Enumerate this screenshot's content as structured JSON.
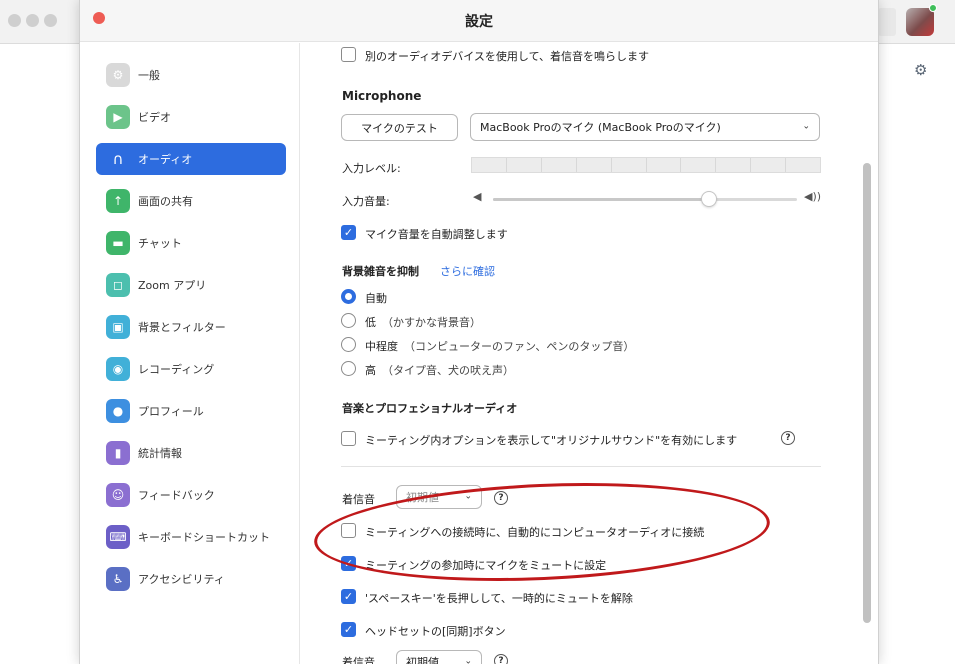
{
  "window": {
    "title": "設定"
  },
  "sidebar": {
    "items": [
      {
        "label": "一般",
        "icon": "gear-icon",
        "color": "#d9d9d9",
        "glyph": "⚙",
        "active": false
      },
      {
        "label": "ビデオ",
        "icon": "video-camera-icon",
        "color": "#6cc48a",
        "glyph": "▶",
        "active": false
      },
      {
        "label": "オーディオ",
        "icon": "headphones-icon",
        "color": "#2d6cdf",
        "glyph": "∩",
        "active": true
      },
      {
        "label": "画面の共有",
        "icon": "share-screen-icon",
        "color": "#3fb56a",
        "glyph": "↑",
        "active": false
      },
      {
        "label": "チャット",
        "icon": "chat-bubble-icon",
        "color": "#3fb56a",
        "glyph": "▬",
        "active": false
      },
      {
        "label": "Zoom アプリ",
        "icon": "apps-icon",
        "color": "#4cbfae",
        "glyph": "◻",
        "active": false
      },
      {
        "label": "背景とフィルター",
        "icon": "background-icon",
        "color": "#41b0d8",
        "glyph": "▣",
        "active": false
      },
      {
        "label": "レコーディング",
        "icon": "record-icon",
        "color": "#41b0d8",
        "glyph": "◉",
        "active": false
      },
      {
        "label": "プロフィール",
        "icon": "profile-icon",
        "color": "#3d8fe0",
        "glyph": "●",
        "active": false
      },
      {
        "label": "統計情報",
        "icon": "statistics-icon",
        "color": "#8b6fd1",
        "glyph": "▮",
        "active": false
      },
      {
        "label": "フィードバック",
        "icon": "feedback-smile-icon",
        "color": "#8b6fd1",
        "glyph": "☺",
        "active": false
      },
      {
        "label": "キーボードショートカット",
        "icon": "keyboard-icon",
        "color": "#6c5fc7",
        "glyph": "⌨",
        "active": false
      },
      {
        "label": "アクセシビリティ",
        "icon": "accessibility-icon",
        "color": "#5a6fc4",
        "glyph": "♿",
        "active": false
      }
    ]
  },
  "audio": {
    "separate_device_label": "別のオーディオデバイスを使用して、着信音を鳴らします",
    "separate_device_checked": false,
    "microphone_heading": "Microphone",
    "test_mic_button": "マイクのテスト",
    "mic_select_value": "MacBook Proのマイク (MacBook Proのマイク)",
    "input_level_label": "入力レベル:",
    "input_level_segments": 10,
    "input_volume_label": "入力音量:",
    "input_volume_value": 0.71,
    "auto_adjust_label": "マイク音量を自動調整します",
    "auto_adjust_checked": true,
    "noise_heading": "背景雑音を抑制",
    "noise_more_link": "さらに確認",
    "noise_options": [
      {
        "label": "自動",
        "hint": "",
        "checked": true
      },
      {
        "label": "低",
        "hint": "（かすかな背景音）",
        "checked": false
      },
      {
        "label": "中程度",
        "hint": "（コンピューターのファン、ペンのタップ音）",
        "checked": false
      },
      {
        "label": "高",
        "hint": "（タイプ音、犬の吠え声）",
        "checked": false
      }
    ],
    "music_heading": "音楽とプロフェショナルオーディオ",
    "original_sound_label": "ミーティング内オプションを表示して\"オリジナルサウンド\"を有効にします",
    "original_sound_checked": false,
    "ringtone_label": "着信音",
    "ringtone_value": "初期値",
    "auto_join_label": "ミーティングへの接続時に、自動的にコンピュータオーディオに接続",
    "auto_join_checked": false,
    "mute_on_join_label": "ミーティングの参加時にマイクをミュートに設定",
    "mute_on_join_checked": true,
    "space_unmute_label": "'スペースキー'を長押しして、一時的にミュートを解除",
    "space_unmute_checked": true,
    "headset_sync_label": "ヘッドセットの[同期]ボタン",
    "headset_sync_checked": true,
    "ringtone2_label": "着信音",
    "ringtone2_value": "初期値"
  },
  "colors": {
    "accent": "#2d6cdf",
    "annotation": "#c0191b"
  }
}
